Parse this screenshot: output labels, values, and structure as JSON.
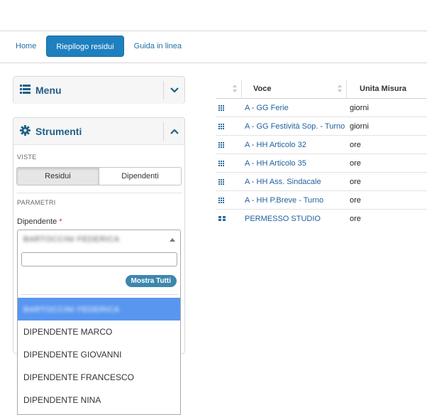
{
  "nav": {
    "tabs": [
      {
        "label": "Home"
      },
      {
        "label": "Riepilogo residui"
      },
      {
        "label": "Guida in linea"
      }
    ]
  },
  "menu_panel": {
    "title": "Menu",
    "icon": "list-icon",
    "toggle_icon": "chevron-down-icon"
  },
  "tools_panel": {
    "title": "Strumenti",
    "icon": "gear-icon",
    "toggle_icon": "chevron-up-icon",
    "views_label": "VISTE",
    "views": [
      {
        "label": "Residui",
        "active": true
      },
      {
        "label": "Dipendenti",
        "active": false
      }
    ],
    "params_label": "PARAMETRI",
    "employee_label": "Dipendente",
    "required_mark": "*",
    "selected_employee": "BARTOCCINI FEDERICA"
  },
  "employee_dropdown": {
    "search_value": "",
    "show_all_label": "Mostra Tutti",
    "options": [
      {
        "label": "BARTOCCINI FEDERICA",
        "selected": true,
        "blurred": true
      },
      {
        "label": "DIPENDENTE MARCO",
        "selected": false
      },
      {
        "label": "DIPENDENTE GIOVANNI",
        "selected": false
      },
      {
        "label": "DIPENDENTE FRANCESCO",
        "selected": false
      },
      {
        "label": "DIPENDENTE NINA",
        "selected": false
      }
    ]
  },
  "table": {
    "columns": [
      "Voce",
      "Unita Misura"
    ],
    "rows": [
      {
        "voce": "A - GG Ferie",
        "unita": "giorni",
        "icon": "grid-icon"
      },
      {
        "voce": "A - GG Festività Sop. - Turno",
        "unita": "giorni",
        "icon": "grid-icon"
      },
      {
        "voce": "A - HH Articolo 32",
        "unita": "ore",
        "icon": "grid-icon"
      },
      {
        "voce": "A - HH Articolo 35",
        "unita": "ore",
        "icon": "grid-icon"
      },
      {
        "voce": "A - HH Ass. Sindacale",
        "unita": "ore",
        "icon": "grid-icon"
      },
      {
        "voce": "A - HH P.Breve - Turno",
        "unita": "ore",
        "icon": "grid-icon"
      },
      {
        "voce": "PERMESSO STUDIO",
        "unita": "ore",
        "icon": "block-grid-icon"
      }
    ]
  },
  "colors": {
    "accent": "#1f80bf",
    "link": "#1f5f9e",
    "selected_option": "#5896f0",
    "badge": "#3d87ad"
  }
}
